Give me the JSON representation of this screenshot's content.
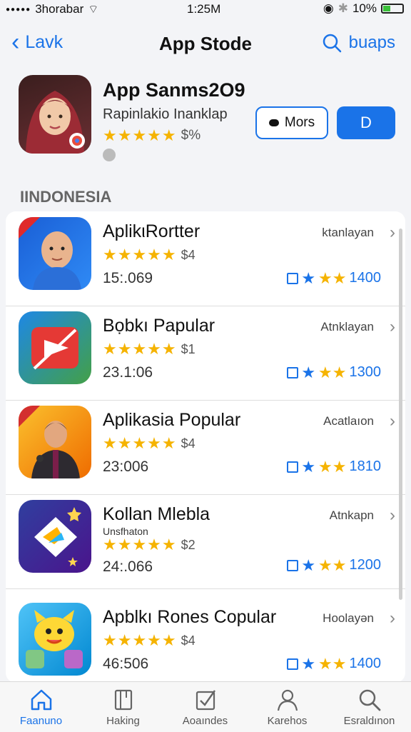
{
  "status": {
    "carrier": "3horabar",
    "time": "1:25M",
    "battery": "10%"
  },
  "nav": {
    "back_label": "Lavk",
    "title": "App Stode",
    "search_label": "buaps"
  },
  "hero": {
    "title": "App Sanms2O9",
    "subtitle": "Rapinlakio Inanklap",
    "stars": "★★★★★",
    "rating": "$%",
    "badge": "0",
    "more_label": "Mors",
    "get_label": "D"
  },
  "section_title": "IINDONESIA",
  "apps": [
    {
      "name": "AplikιRortter",
      "sub": "",
      "stars": "★★★★★",
      "price": "$4",
      "count": "15:.069",
      "category": "ktanlayan",
      "downloads": "1400"
    },
    {
      "name": "Bọbkı Papular",
      "sub": "",
      "stars": "★★★★★",
      "price": "$1",
      "count": "23.1:06",
      "category": "Atnklayan",
      "downloads": "1300"
    },
    {
      "name": "Aplikasia Popular",
      "sub": "",
      "stars": "★★★★★",
      "price": "$4",
      "count": "23:006",
      "category": "Acatlaıon",
      "downloads": "1810"
    },
    {
      "name": "Kollan Mlebla",
      "sub": "Unsfhaton",
      "stars": "★★★★★",
      "price": "$2",
      "count": "24:.066",
      "category": "Atnkapn",
      "downloads": "1200"
    },
    {
      "name": "Apblkı Rones Copular",
      "sub": "",
      "stars": "★★★★★",
      "price": "$4",
      "count": "46:506",
      "category": "Hoolayən",
      "downloads": "1400"
    }
  ],
  "tabs": [
    {
      "label": "Faanuno"
    },
    {
      "label": "Haking"
    },
    {
      "label": "Aoaındes"
    },
    {
      "label": "Karehos"
    },
    {
      "label": "Esraldınon"
    }
  ]
}
